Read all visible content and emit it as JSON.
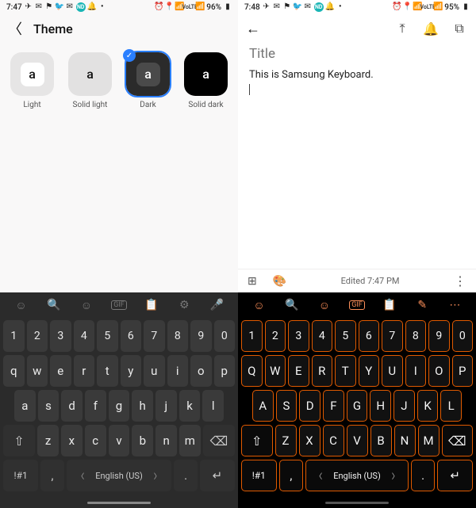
{
  "left": {
    "status": {
      "time": "7:47",
      "battery": "96%",
      "lte": "LTE1",
      "volte": "VoLTE"
    },
    "title": "Theme",
    "themes": [
      {
        "key": "light",
        "label": "Light",
        "glyph": "a"
      },
      {
        "key": "solidlight",
        "label": "Solid light",
        "glyph": "a"
      },
      {
        "key": "dark",
        "label": "Dark",
        "glyph": "a",
        "selected": true
      },
      {
        "key": "soliddark",
        "label": "Solid dark",
        "glyph": "a"
      }
    ],
    "keyboard": {
      "toolbar": [
        "emoji",
        "search",
        "sticker",
        "gif",
        "clipboard",
        "settings",
        "mic"
      ],
      "numbers": [
        "1",
        "2",
        "3",
        "4",
        "5",
        "6",
        "7",
        "8",
        "9",
        "0"
      ],
      "row1": [
        "q",
        "w",
        "e",
        "r",
        "t",
        "y",
        "u",
        "i",
        "o",
        "p"
      ],
      "row2": [
        "a",
        "s",
        "d",
        "f",
        "g",
        "h",
        "j",
        "k",
        "l"
      ],
      "row3": [
        "z",
        "x",
        "c",
        "v",
        "b",
        "n",
        "m"
      ],
      "shift": "⇧",
      "backspace": "⌫",
      "symbols": "!#1",
      "comma": ",",
      "language": "English (US)",
      "period": ".",
      "enter": "↵"
    }
  },
  "right": {
    "status": {
      "time": "7:48",
      "battery": "95%",
      "lte": "LTE1",
      "volte": "VoLTE"
    },
    "note": {
      "title_placeholder": "Title",
      "body": "This is Samsung Keyboard.",
      "edited_label": "Edited 7:47 PM"
    },
    "keyboard": {
      "toolbar": [
        "emoji",
        "search",
        "sticker",
        "gif",
        "clipboard",
        "handwrite",
        "more"
      ],
      "numbers": [
        "1",
        "2",
        "3",
        "4",
        "5",
        "6",
        "7",
        "8",
        "9",
        "0"
      ],
      "row1": [
        "Q",
        "W",
        "E",
        "R",
        "T",
        "Y",
        "U",
        "I",
        "O",
        "P"
      ],
      "row2": [
        "A",
        "S",
        "D",
        "F",
        "G",
        "H",
        "J",
        "K",
        "L"
      ],
      "row3": [
        "Z",
        "X",
        "C",
        "V",
        "B",
        "N",
        "M"
      ],
      "shift": "⇧",
      "backspace": "⌫",
      "symbols": "!#1",
      "comma": ",",
      "language": "English (US)",
      "period": ".",
      "enter": "↵"
    }
  },
  "icons": {
    "emoji": "☺",
    "search": "🔍",
    "sticker": "☺",
    "gif": "GIF",
    "clipboard": "📋",
    "settings": "⚙",
    "mic": "🎤",
    "handwrite": "✎",
    "more": "⋯",
    "pin": "📌",
    "bell": "🔔",
    "archive": "🗃",
    "add_box": "⊞",
    "palette": "🎨"
  }
}
